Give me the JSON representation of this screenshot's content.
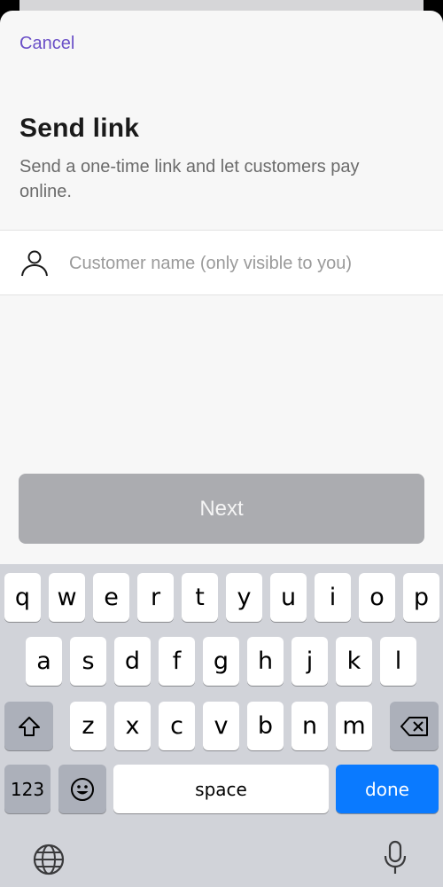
{
  "header": {
    "cancel_label": "Cancel"
  },
  "content": {
    "title": "Send link",
    "subtitle": "Send a one-time link and let customers pay online."
  },
  "customer_field": {
    "icon": "person-icon",
    "placeholder": "Customer name (only visible to you)",
    "value": ""
  },
  "next_button": {
    "label": "Next",
    "enabled": false
  },
  "keyboard": {
    "row1": [
      "q",
      "w",
      "e",
      "r",
      "t",
      "y",
      "u",
      "i",
      "o",
      "p"
    ],
    "row2": [
      "a",
      "s",
      "d",
      "f",
      "g",
      "h",
      "j",
      "k",
      "l"
    ],
    "row3": [
      "z",
      "x",
      "c",
      "v",
      "b",
      "n",
      "m"
    ],
    "numbers_label": "123",
    "space_label": "space",
    "done_label": "done",
    "icons": {
      "shift": "shift-icon",
      "backspace": "backspace-icon",
      "emoji": "emoji-icon",
      "globe": "globe-icon",
      "mic": "microphone-icon"
    },
    "colors": {
      "done": "#0a7aff",
      "background": "#d1d3d9"
    }
  },
  "colors": {
    "accent": "#6a4fc7",
    "disabled_button": "#abacb0"
  }
}
